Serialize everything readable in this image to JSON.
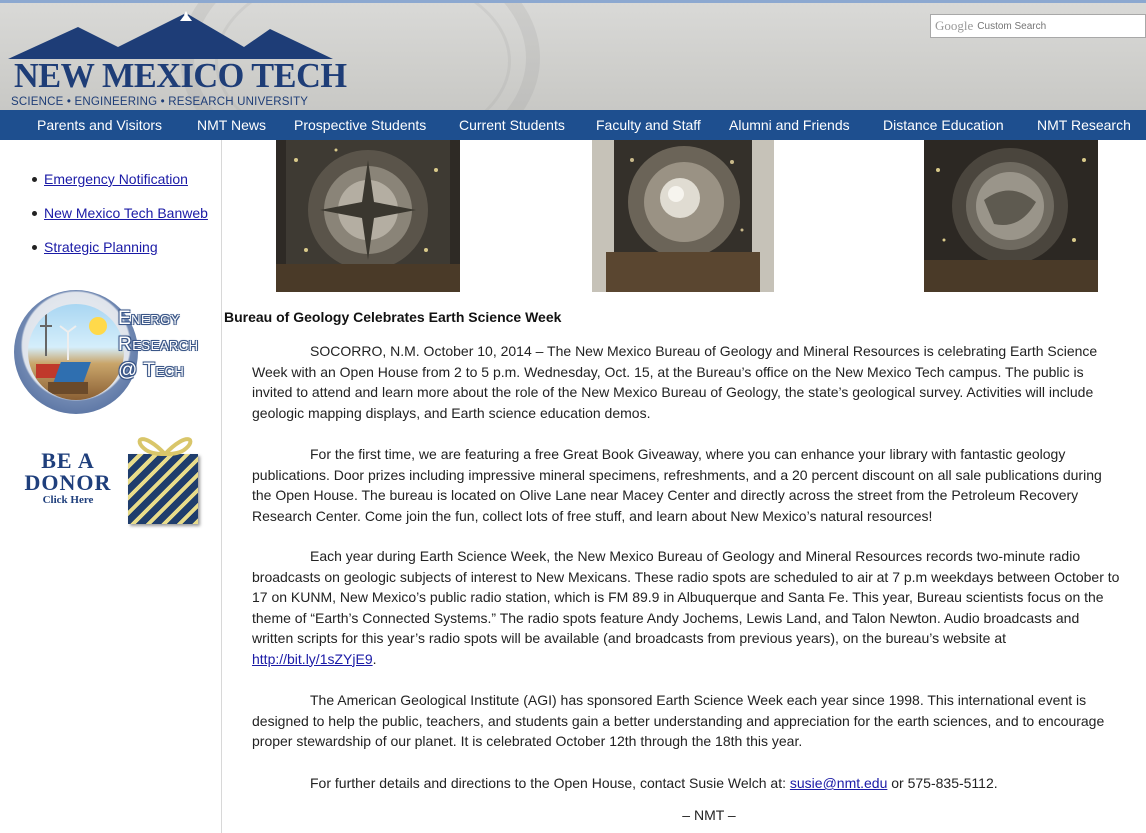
{
  "header": {
    "logo_text": "NEW MEXICO TECH",
    "tagline": "SCIENCE • ENGINEERING • RESEARCH UNIVERSITY",
    "search": {
      "brand": "Google",
      "placeholder": "Custom Search"
    }
  },
  "nav": {
    "items": [
      "Parents and Visitors",
      "NMT News",
      "Prospective Students",
      "Current Students",
      "Faculty and Staff",
      "Alumni and Friends",
      "Distance Education",
      "NMT Research"
    ],
    "color": "#1e4f8f"
  },
  "sidebar": {
    "links": [
      "Emergency Notification",
      "New Mexico Tech Banweb",
      "Strategic Planning"
    ],
    "energy_badge": [
      "Energy",
      "Research",
      "@ Tech"
    ],
    "donor_badge": {
      "line1": "BE A",
      "line2": "DONOR",
      "line3": "Click Here"
    }
  },
  "article": {
    "title": "Bureau of Geology Celebrates Earth Science Week",
    "p1": "SOCORRO, N.M. October 10, 2014 – The New Mexico Bureau of Geology and Mineral Resources is celebrating Earth Science Week with an Open House from 2 to 5 p.m. Wednesday, Oct. 15, at the Bureau’s office on the New Mexico Tech campus. The public is invited to attend and learn more about the role of the New Mexico Bureau of Geology, the state’s geological survey. Activities will include geologic mapping displays, and Earth science education demos.",
    "p2": "For the first time, we are featuring a free Great Book Giveaway, where you can enhance your library with fantastic geology publications. Door prizes including impressive mineral specimens, refreshments, and a 20 percent discount on all sale publications during the Open House. The bureau is located on Olive Lane near Macey Center and directly across the street from the Petroleum Recovery Research Center. Come join the fun, collect lots of free stuff, and learn about New Mexico’s natural resources!",
    "p3_text": "Each year during Earth Science Week, the New Mexico Bureau of Geology and Mineral Resources records two-minute radio broadcasts on geologic subjects of interest to New Mexicans. These radio spots are scheduled to air at 7 p.m weekdays between October to 17 on KUNM, New Mexico’s public radio station, which is FM 89.9 in Albuquerque and Santa Fe. This year, Bureau scientists focus on the theme of “Earth’s Connected Systems.” The radio spots feature Andy Jochems, Lewis Land, and Talon Newton. Audio broadcasts and written scripts for this year’s radio spots will be available (and broadcasts from previous years), on the bureau’s website at ",
    "p3_link": "http://bit.ly/1sZYjE9",
    "p3_end": ".",
    "p4": "The American Geological Institute (AGI) has sponsored Earth Science Week each year since 1998. This international event is designed to help the public, teachers, and students gain a better understanding and appreciation for the earth sciences, and to encourage proper stewardship of our planet. It is celebrated October 12th through the 18th this year.",
    "p5_text": "For further details and directions to the Open House, contact Susie Welch at: ",
    "p5_link": "susie@nmt.edu",
    "p5_end": " or 575-835-5112.",
    "signoff": "– NMT –"
  },
  "colors": {
    "brand_blue": "#1e3d77",
    "link": "#1a1aa6",
    "header_bg": "#d3d3d1"
  }
}
